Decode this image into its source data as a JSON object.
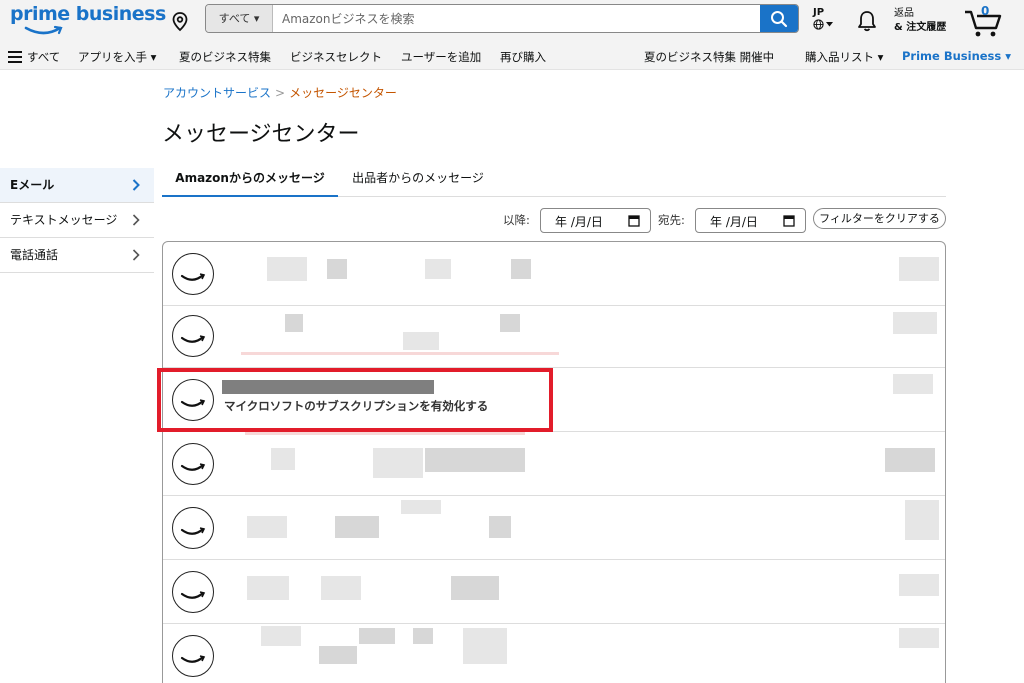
{
  "header": {
    "logo_text": "prime business",
    "search_category": "すべて ▾",
    "search_placeholder": "Amazonビジネスを検索",
    "lang_label": "JP",
    "returns_line1": "返品",
    "returns_line2": "& 注文履歴",
    "cart_count": "0"
  },
  "nav": {
    "all_label": "すべて",
    "items": [
      "アプリを入手 ▾",
      "夏のビジネス特集",
      "ビジネスセレクト",
      "ユーザーを追加",
      "再び購入"
    ],
    "promo": "夏のビジネス特集 開催中",
    "lists": "購入品リスト ▾",
    "prime_business": "Prime Business ▾"
  },
  "breadcrumb": {
    "parent": "アカウントサービス",
    "separator": ">",
    "current": "メッセージセンター"
  },
  "page_title": "メッセージセンター",
  "sidebar": {
    "items": [
      {
        "label": "Eメール",
        "active": true
      },
      {
        "label": "テキストメッセージ",
        "active": false
      },
      {
        "label": "電話通話",
        "active": false
      }
    ]
  },
  "tabs": [
    {
      "label": "Amazonからのメッセージ",
      "active": true
    },
    {
      "label": "出品者からのメッセージ",
      "active": false
    }
  ],
  "filters": {
    "from_label": "以降:",
    "to_label": "宛先:",
    "date_placeholder": "年 /月/日",
    "clear_label": "フィルターをクリアする"
  },
  "messages": {
    "highlighted_subject": "マイクロソフトのサブスクリプションを有効化する"
  },
  "colors": {
    "accent": "#1a73c8",
    "breadcrumb_current": "#c45500",
    "highlight_border": "#e21c2a"
  }
}
